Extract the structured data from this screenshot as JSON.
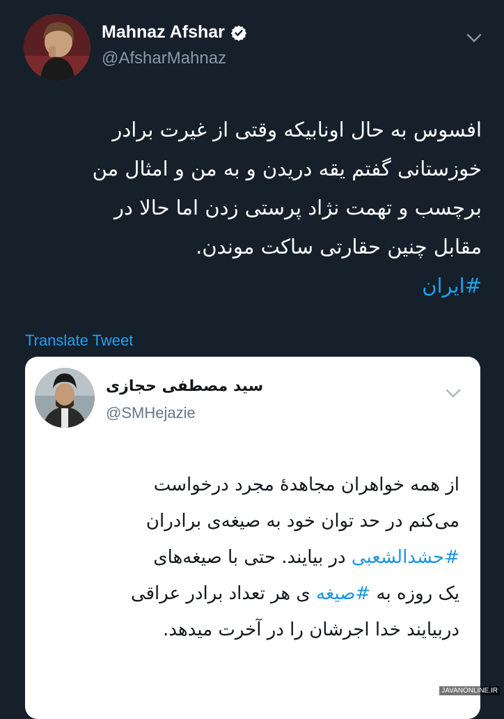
{
  "author": {
    "name": "Mahnaz Afshar",
    "handle": "@AfsharMahnaz",
    "verified": true,
    "avatar_icon": "profile-photo"
  },
  "tweet": {
    "lines": [
      "افسوس به حال اونابیکه وقتی از غیرت برادر",
      "خوزستانی گفتم یقه دریدن و به من و امثال من",
      "برچسب و تهمت نژاد پرستی زدن اما حالا در",
      "مقابل چنین حقارتی ساکت موندن."
    ],
    "hashtag": "#ایران"
  },
  "translate_label": "Translate Tweet",
  "quoted": {
    "name": "سید مصطفی حجازی",
    "handle": "@SMHejazie",
    "avatar_icon": "profile-photo",
    "lines": [
      {
        "parts": [
          {
            "text": "از همه خواهران مجاهدهٔ مجرد درخواست",
            "tag": false
          }
        ]
      },
      {
        "parts": [
          {
            "text": "می‌کنم در حد توان خود به صیغه‌ی برادران",
            "tag": false
          }
        ]
      },
      {
        "parts": [
          {
            "text": "#حشدالشعبی",
            "tag": true
          },
          {
            "text": " در بیایند. حتی با صیغه‌های",
            "tag": false
          }
        ]
      },
      {
        "parts": [
          {
            "text": "یک روزه به ",
            "tag": false
          },
          {
            "text": "#صیغه",
            "tag": true
          },
          {
            "text": " ی هر تعداد برادر عراقی",
            "tag": false
          }
        ]
      },
      {
        "parts": [
          {
            "text": "دربیایند خدا اجرشان را در آخرت میدهد.",
            "tag": false
          }
        ]
      }
    ]
  },
  "watermark": "JAVANONLINE.IR",
  "colors": {
    "background": "#15202b",
    "link": "#1da1f2",
    "secondary_text": "#8899a6"
  }
}
